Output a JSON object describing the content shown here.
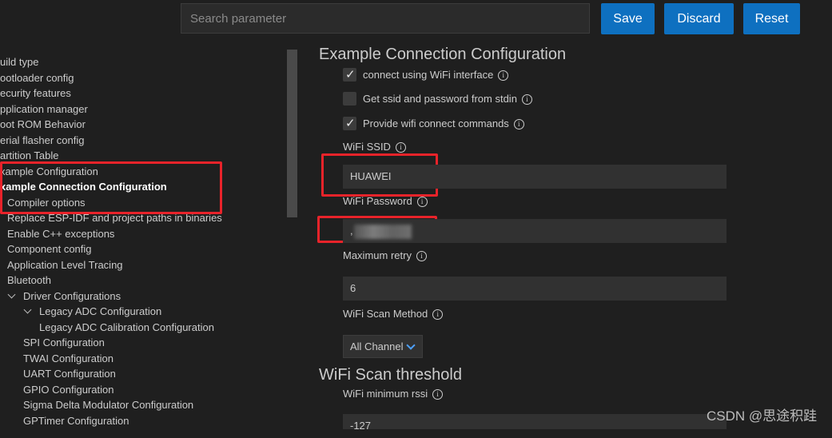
{
  "toolbar": {
    "search_placeholder": "Search parameter",
    "save_label": "Save",
    "discard_label": "Discard",
    "reset_label": "Reset"
  },
  "sidebar": {
    "items": [
      {
        "label": "uild type"
      },
      {
        "label": "ootloader config"
      },
      {
        "label": "ecurity features"
      },
      {
        "label": "pplication manager"
      },
      {
        "label": "oot ROM Behavior"
      },
      {
        "label": "erial flasher config"
      },
      {
        "label": "artition Table"
      },
      {
        "label": "xample Configuration"
      },
      {
        "label": "xample Connection Configuration"
      },
      {
        "label": "Compiler options"
      },
      {
        "label": "Replace ESP-IDF and project paths in binaries"
      },
      {
        "label": "Enable C++ exceptions"
      },
      {
        "label": "Component config"
      },
      {
        "label": "Application Level Tracing"
      },
      {
        "label": "Bluetooth"
      },
      {
        "label": "Driver Configurations"
      },
      {
        "label": "Legacy ADC Configuration"
      },
      {
        "label": "Legacy ADC Calibration Configuration"
      },
      {
        "label": "SPI Configuration"
      },
      {
        "label": "TWAI Configuration"
      },
      {
        "label": "UART Configuration"
      },
      {
        "label": "GPIO Configuration"
      },
      {
        "label": "Sigma Delta Modulator Configuration"
      },
      {
        "label": "GPTimer Configuration"
      }
    ]
  },
  "content": {
    "section_title": "Example Connection Configuration",
    "checkboxes": [
      {
        "label": "connect using WiFi interface",
        "checked": true
      },
      {
        "label": "Get ssid and password from stdin",
        "checked": false
      },
      {
        "label": "Provide wifi connect commands",
        "checked": true
      }
    ],
    "ssid_label": "WiFi SSID",
    "ssid_value": "HUAWEI",
    "password_label": "WiFi Password",
    "password_value": ",",
    "retry_label": "Maximum retry",
    "retry_value": "6",
    "scan_method_label": "WiFi Scan Method",
    "scan_method_value": "All Channel",
    "scan_threshold_title": "WiFi Scan threshold",
    "rssi_label": "WiFi minimum rssi",
    "rssi_value": "-127"
  },
  "watermark": "CSDN @思途积跬",
  "colors": {
    "accent": "#0e70c0",
    "highlight_box": "#e8232a",
    "background": "#1f1f1f"
  }
}
